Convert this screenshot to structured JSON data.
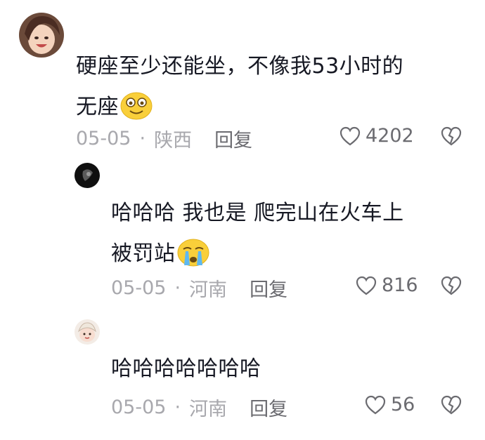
{
  "comments": [
    {
      "text": "硬座至少还能坐，不像我53小时的无座",
      "date": "05-05",
      "location": "陕西",
      "reply_label": "回复",
      "likes": "4202",
      "avatar_icon": "girl-avatar",
      "emoji_icon": "drooling-face-emoji"
    },
    {
      "text": "哈哈哈 我也是 爬完山在火车上被罚站",
      "date": "05-05",
      "location": "河南",
      "reply_label": "回复",
      "likes": "816",
      "avatar_icon": "dark-avatar",
      "emoji_icon": "crying-face-emoji"
    },
    {
      "text": "哈哈哈哈哈哈哈",
      "date": "05-05",
      "location": "河南",
      "reply_label": "回复",
      "likes": "56",
      "avatar_icon": "cartoon-avatar"
    }
  ],
  "colors": {
    "text": "#161823",
    "meta": "#a8a8ad",
    "action": "#6b6b70",
    "emoji": "#f9cf3a"
  }
}
